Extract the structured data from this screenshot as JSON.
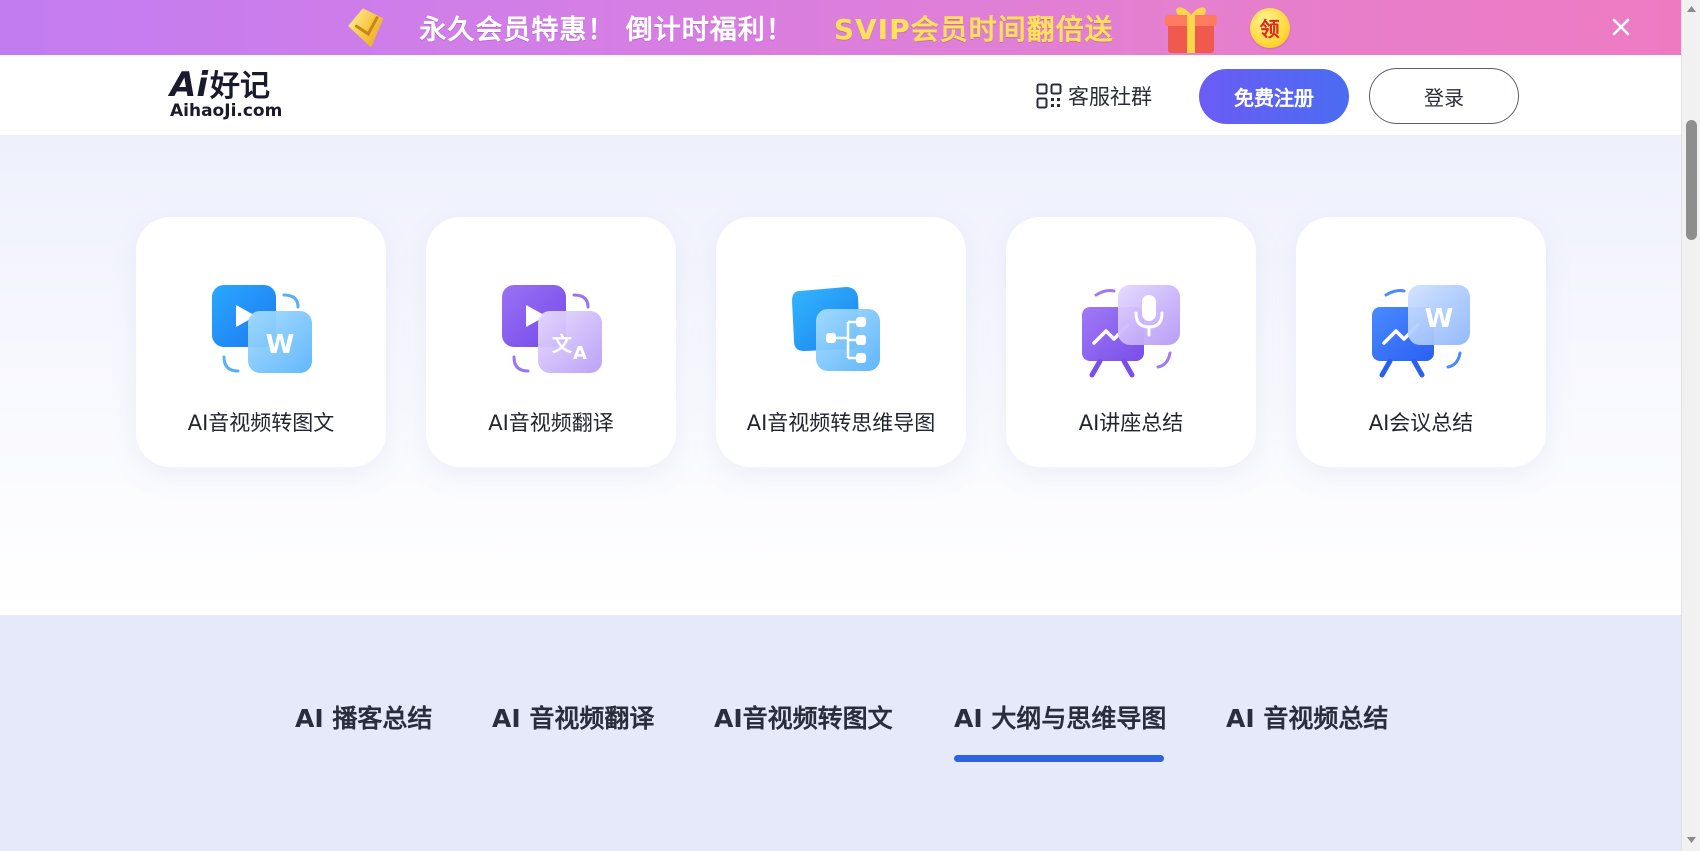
{
  "promo": {
    "text_main": "永久会员特惠！ 倒计时福利！",
    "text_highlight": "SVIP会员时间翻倍送",
    "claim_label": "领",
    "icons": [
      "diamond-badge-icon",
      "gift-box-icon",
      "close-icon"
    ]
  },
  "header": {
    "logo_ai": "Ai",
    "logo_cn": "好记",
    "logo_url": "AihaoJi.com",
    "service_label": "客服社群",
    "register_label": "免费注册",
    "login_label": "登录"
  },
  "features": [
    {
      "label": "AI音视频转图文",
      "icon": "video-to-word-icon"
    },
    {
      "label": "AI音视频翻译",
      "icon": "video-translate-icon"
    },
    {
      "label": "AI音视频转思维导图",
      "icon": "video-mindmap-icon"
    },
    {
      "label": "AI讲座总结",
      "icon": "lecture-mic-icon"
    },
    {
      "label": "AI会议总结",
      "icon": "meeting-word-icon"
    }
  ],
  "tabs": [
    {
      "label": "AI 播客总结",
      "active": false
    },
    {
      "label": "AI 音视频翻译",
      "active": false
    },
    {
      "label": "AI音视频转图文",
      "active": false
    },
    {
      "label": "AI 大纲与思维导图",
      "active": true
    },
    {
      "label": "AI 音视频总结",
      "active": false
    }
  ],
  "colors": {
    "brand_primary": "#5b62f4",
    "tab_active_underline": "#2e62e0",
    "promo_highlight": "#ffe15a",
    "promo_gradient_start": "#c27cf0",
    "promo_gradient_end": "#ee7bc2"
  }
}
